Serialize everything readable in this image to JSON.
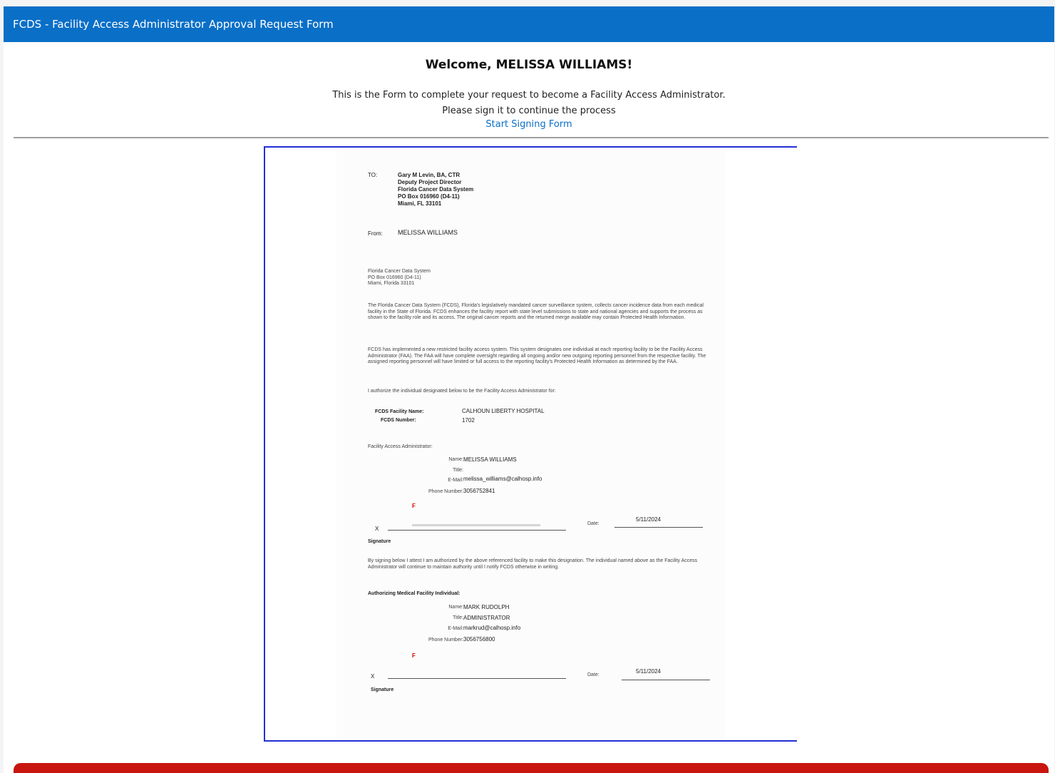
{
  "header": {
    "title": "FCDS - Facility Access Administrator Approval Request Form"
  },
  "welcome": {
    "text": "Welcome, MELISSA WILLIAMS!"
  },
  "intro": {
    "line1": "This is the Form to complete your request to become a Facility Access Administrator.",
    "line2": "Please sign it to continue the process",
    "link": "Start Signing Form"
  },
  "document": {
    "to_label": "TO:",
    "to_lines": [
      "Gary M Levin, BA, CTR",
      "Deputy Project Director",
      "Florida Cancer Data System",
      "PO Box 016960 (D4-11)",
      "Miami, FL 33101"
    ],
    "from_label": "From:",
    "from_name": "MELISSA WILLIAMS",
    "address_lines": [
      "Florida Cancer Data System",
      "PO Box 016960 (D4-11)",
      "Miami, Florida 33101"
    ],
    "para1": "The Florida Cancer Data System (FCDS), Florida's legislatively mandated cancer surveillance system, collects cancer incidence data from each medical facility in the State of Florida. FCDS enhances the facility report with state level submissions to state and national agencies and supports the process as shown to the facility role and its access. The original cancer reports and the returned merge available may contain Protected Health Information.",
    "para2": "FCDS has implemented a new restricted facility access system. This system designates one individual at each reporting facility to be the Facility Access Administrator (FAA). The FAA will have complete oversight regarding all ongoing and/or new outgoing reporting personnel from the respective facility. The assigned reporting personnel will have limited or full access to the reporting facility's Protected Health Information as determined by the FAA.",
    "para3": "I authorize the individual designated below to be the Facility Access Administrator for:",
    "facility_name_label": "FCDS Facility Name:",
    "facility_name": "CALHOUN LIBERTY HOSPITAL",
    "fcds_number_label": "FCDS Number:",
    "fcds_number": "1702",
    "faa_heading": "Facility Access Administrator:",
    "faa_name_label": "Name:",
    "faa_name": "MELISSA WILLIAMS",
    "faa_title_label": "Title:",
    "faa_title": "",
    "faa_email_label": "E-Mail:",
    "faa_email": "melissa_williams@calhosp.info",
    "faa_phone_label": "Phone Number:",
    "faa_phone": "3056752841",
    "sig_x": "X",
    "sig_label": "Signature",
    "date_label": "Date:",
    "faa_date": "5/11/2024",
    "para4": "By signing below I attest I am authorized by the above referenced facility to make this designation. The individual named above as the Facility Access Administrator will continue to maintain authority until I notify FCDS otherwise in writing.",
    "auth_heading": "Authorizing Medical Facility Individual:",
    "auth_name_label": "Name:",
    "auth_name": "MARK RUDOLPH",
    "auth_title_label": "Title:",
    "auth_title": "ADMINISTRATOR",
    "auth_email_label": "E-Mail:",
    "auth_email": "markrud@calhosp.info",
    "auth_phone_label": "Phone Number:",
    "auth_phone": "3056756800",
    "auth_date": "5/11/2024",
    "flag_mark": "F"
  },
  "colors": {
    "header_bg": "#0a6fc7",
    "link": "#0a6fc7",
    "frame": "#2430d6",
    "alert": "#c8150f"
  }
}
